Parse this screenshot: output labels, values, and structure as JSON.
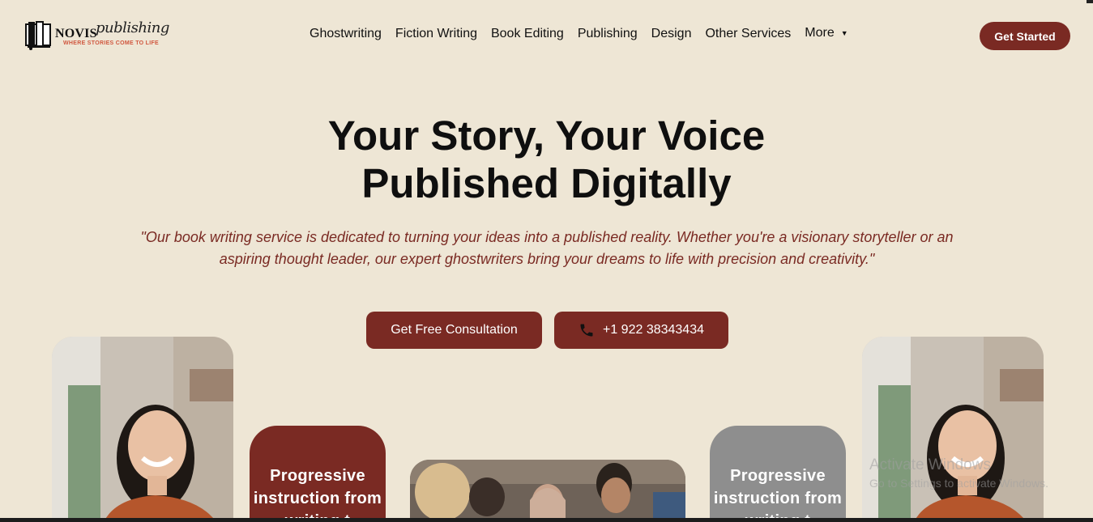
{
  "brand": {
    "name": "NOVIS",
    "script": "publishing",
    "tagline": "WHERE STORIES COME TO LIFE"
  },
  "nav": {
    "items": [
      "Ghostwriting",
      "Fiction Writing",
      "Book Editing",
      "Publishing",
      "Design",
      "Other Services"
    ],
    "more_label": "More",
    "cta_label": "Get Started"
  },
  "hero": {
    "title_line1": "Your Story, Your Voice",
    "title_line2": "Published Digitally",
    "quote": "\"Our book writing service is dedicated to turning your ideas into a published reality. Whether you're a visionary storyteller or an aspiring thought leader, our expert ghostwriters bring your dreams to life with precision and creativity.\"",
    "consult_label": "Get Free Consultation",
    "phone_label": "+1 922 38343434"
  },
  "cards": {
    "red_text": "Progressive instruction from writing t",
    "grey_text": "Progressive instruction from writing t"
  },
  "watermark": {
    "title": "Activate Windows",
    "subtitle": "Go to Settings to activate Windows."
  },
  "colors": {
    "background": "#EEE6D5",
    "brand": "#7A2A23",
    "grey_card": "#8E8E8E"
  }
}
